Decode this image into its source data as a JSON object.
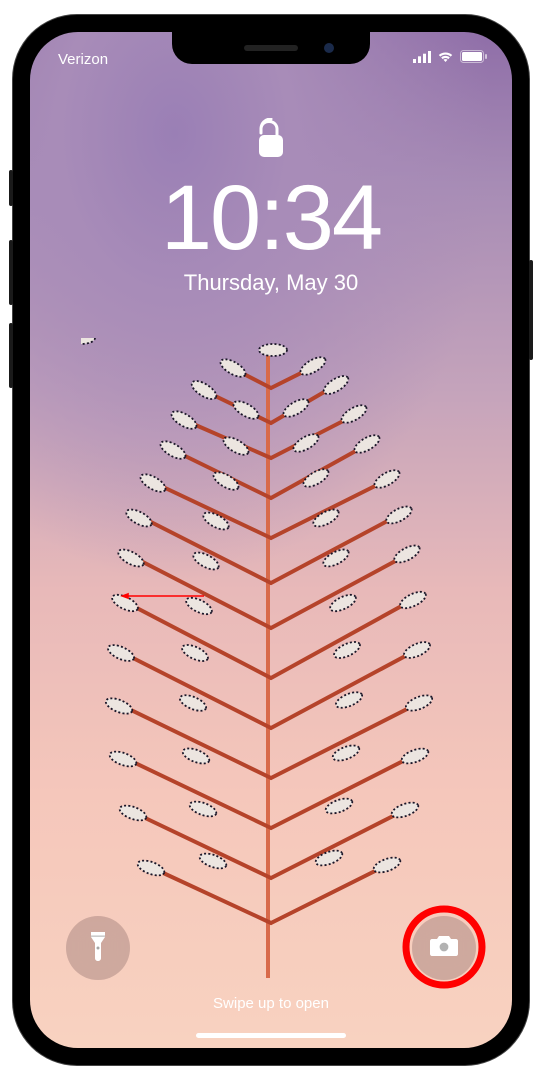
{
  "status": {
    "carrier": "Verizon",
    "signal_bars": 4,
    "wifi_bars": 3,
    "battery_pct": 95
  },
  "lock": {
    "state": "unlocked"
  },
  "clock": {
    "time": "10:34",
    "date": "Thursday, May 30"
  },
  "shortcuts": {
    "flashlight_icon": "flashlight-icon",
    "camera_icon": "camera-icon"
  },
  "hint": {
    "swipe_label": "Swipe up to open"
  },
  "annotation": {
    "arrow_color": "#ff0000",
    "ring_color": "#ff0000",
    "direction": "left"
  }
}
